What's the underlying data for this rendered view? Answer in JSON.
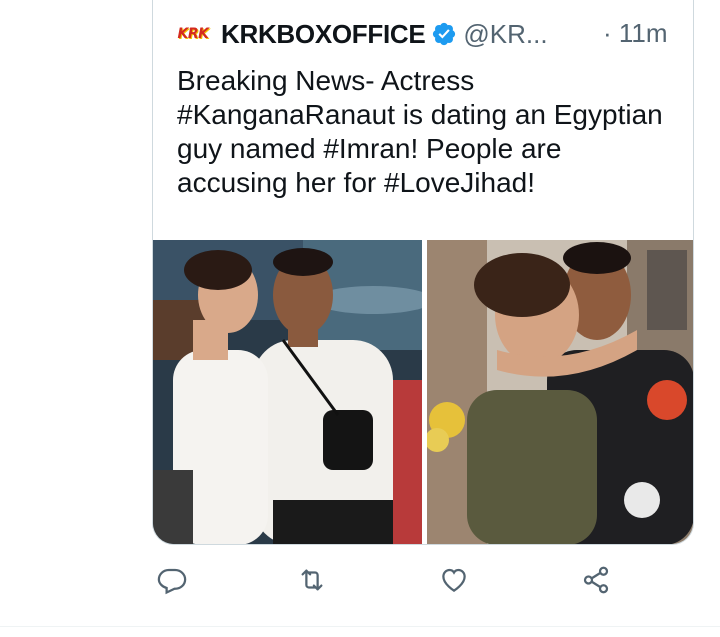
{
  "tweet": {
    "author_name": "KRKBOXOFFICE",
    "handle": "@KR...",
    "time": "· 11m",
    "logo_text": "KRK",
    "text": "Breaking News- Actress #KanganaRanaut is dating an Egyptian guy named #Imran! People are accusing her for #LoveJihad!",
    "verified": true
  },
  "actions": {
    "reply_icon": "reply-icon",
    "retweet_icon": "retweet-icon",
    "like_icon": "like-icon",
    "share_icon": "share-icon"
  },
  "colors": {
    "text": "#0f1419",
    "secondary": "#536471",
    "verified": "#1d9bf0",
    "border": "#cfd9de",
    "logo_red": "#d42a1f"
  }
}
